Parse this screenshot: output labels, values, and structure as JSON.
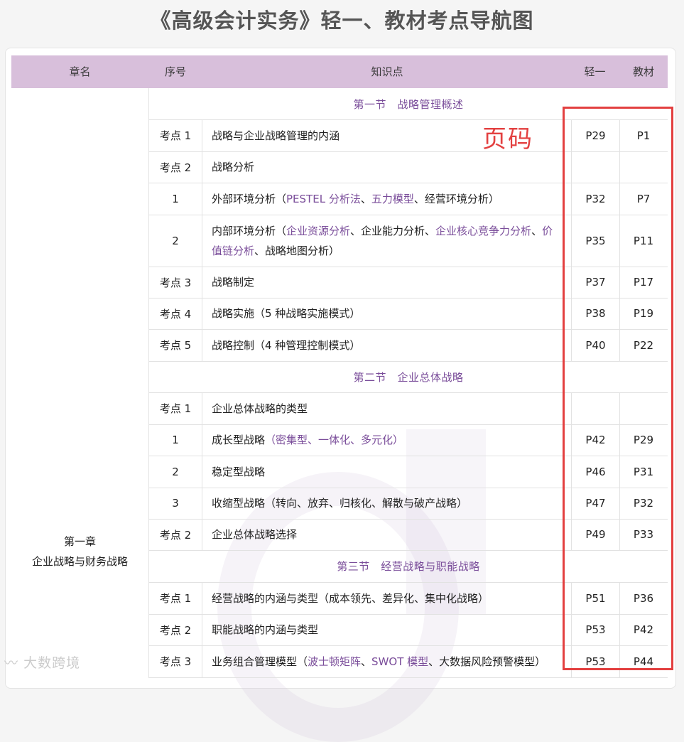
{
  "title": "《高级会计实务》轻一、教材考点导航图",
  "headers": {
    "chapter": "章名",
    "index": "序号",
    "knowledge": "知识点",
    "qingyi": "轻一",
    "textbook": "教材"
  },
  "chapter": {
    "line1": "第一章",
    "line2": "企业战略与财务战略"
  },
  "annotation": "页码",
  "logo": "大数跨境",
  "sections": [
    "第一节　战略管理概述",
    "第二节　企业总体战略",
    "第三节　经营战略与职能战略"
  ],
  "rows": [
    {
      "num": "考点 1",
      "topic": [
        "战略与企业战略管理的内涵"
      ],
      "qingyi": "P29",
      "textbook": "P1"
    },
    {
      "num": "考点 2",
      "topic": [
        "战略分析"
      ],
      "qingyi": "",
      "textbook": ""
    },
    {
      "num": "1",
      "topic": [
        "外部环境分析（",
        "PESTEL 分析法",
        "、",
        "五力模型",
        "、经营环境分析）"
      ],
      "qingyi": "P32",
      "textbook": "P7"
    },
    {
      "num": "2",
      "topic": [
        "内部环境分析（",
        "企业资源分析",
        "、企业能力分析、",
        "企业核心竞争力分析",
        "、",
        "价值链分析",
        "、战略地图分析）"
      ],
      "qingyi": "P35",
      "textbook": "P11"
    },
    {
      "num": "考点 3",
      "topic": [
        "战略制定"
      ],
      "qingyi": "P37",
      "textbook": "P17"
    },
    {
      "num": "考点 4",
      "topic": [
        "战略实施（5 种战略实施模式）"
      ],
      "qingyi": "P38",
      "textbook": "P19"
    },
    {
      "num": "考点 5",
      "topic": [
        "战略控制（4 种管理控制模式）"
      ],
      "qingyi": "P40",
      "textbook": "P22"
    },
    {
      "num": "考点 1",
      "topic": [
        "企业总体战略的类型"
      ],
      "qingyi": "",
      "textbook": ""
    },
    {
      "num": "1",
      "topic": [
        "成长型战略",
        "（密集型、一体化、多元化）"
      ],
      "qingyi": "P42",
      "textbook": "P29"
    },
    {
      "num": "2",
      "topic": [
        "稳定型战略"
      ],
      "qingyi": "P46",
      "textbook": "P31"
    },
    {
      "num": "3",
      "topic": [
        "收缩型战略（转向、放弃、归核化、解散与破产战略）"
      ],
      "qingyi": "P47",
      "textbook": "P32"
    },
    {
      "num": "考点 2",
      "topic": [
        "企业总体战略选择"
      ],
      "qingyi": "P49",
      "textbook": "P33"
    },
    {
      "num": "考点 1",
      "topic": [
        "经营战略的内涵与类型（成本领先、差异化、集中化战略）"
      ],
      "qingyi": "P51",
      "textbook": "P36"
    },
    {
      "num": "考点 2",
      "topic": [
        "职能战略的内涵与类型"
      ],
      "qingyi": "P53",
      "textbook": "P42"
    },
    {
      "num": "考点 3",
      "topic": [
        "业务组合管理模型（",
        "波士顿矩阵",
        "、",
        "SWOT 模型",
        "、大数据风险预警模型）"
      ],
      "qingyi": "P53",
      "textbook": "P44"
    }
  ]
}
